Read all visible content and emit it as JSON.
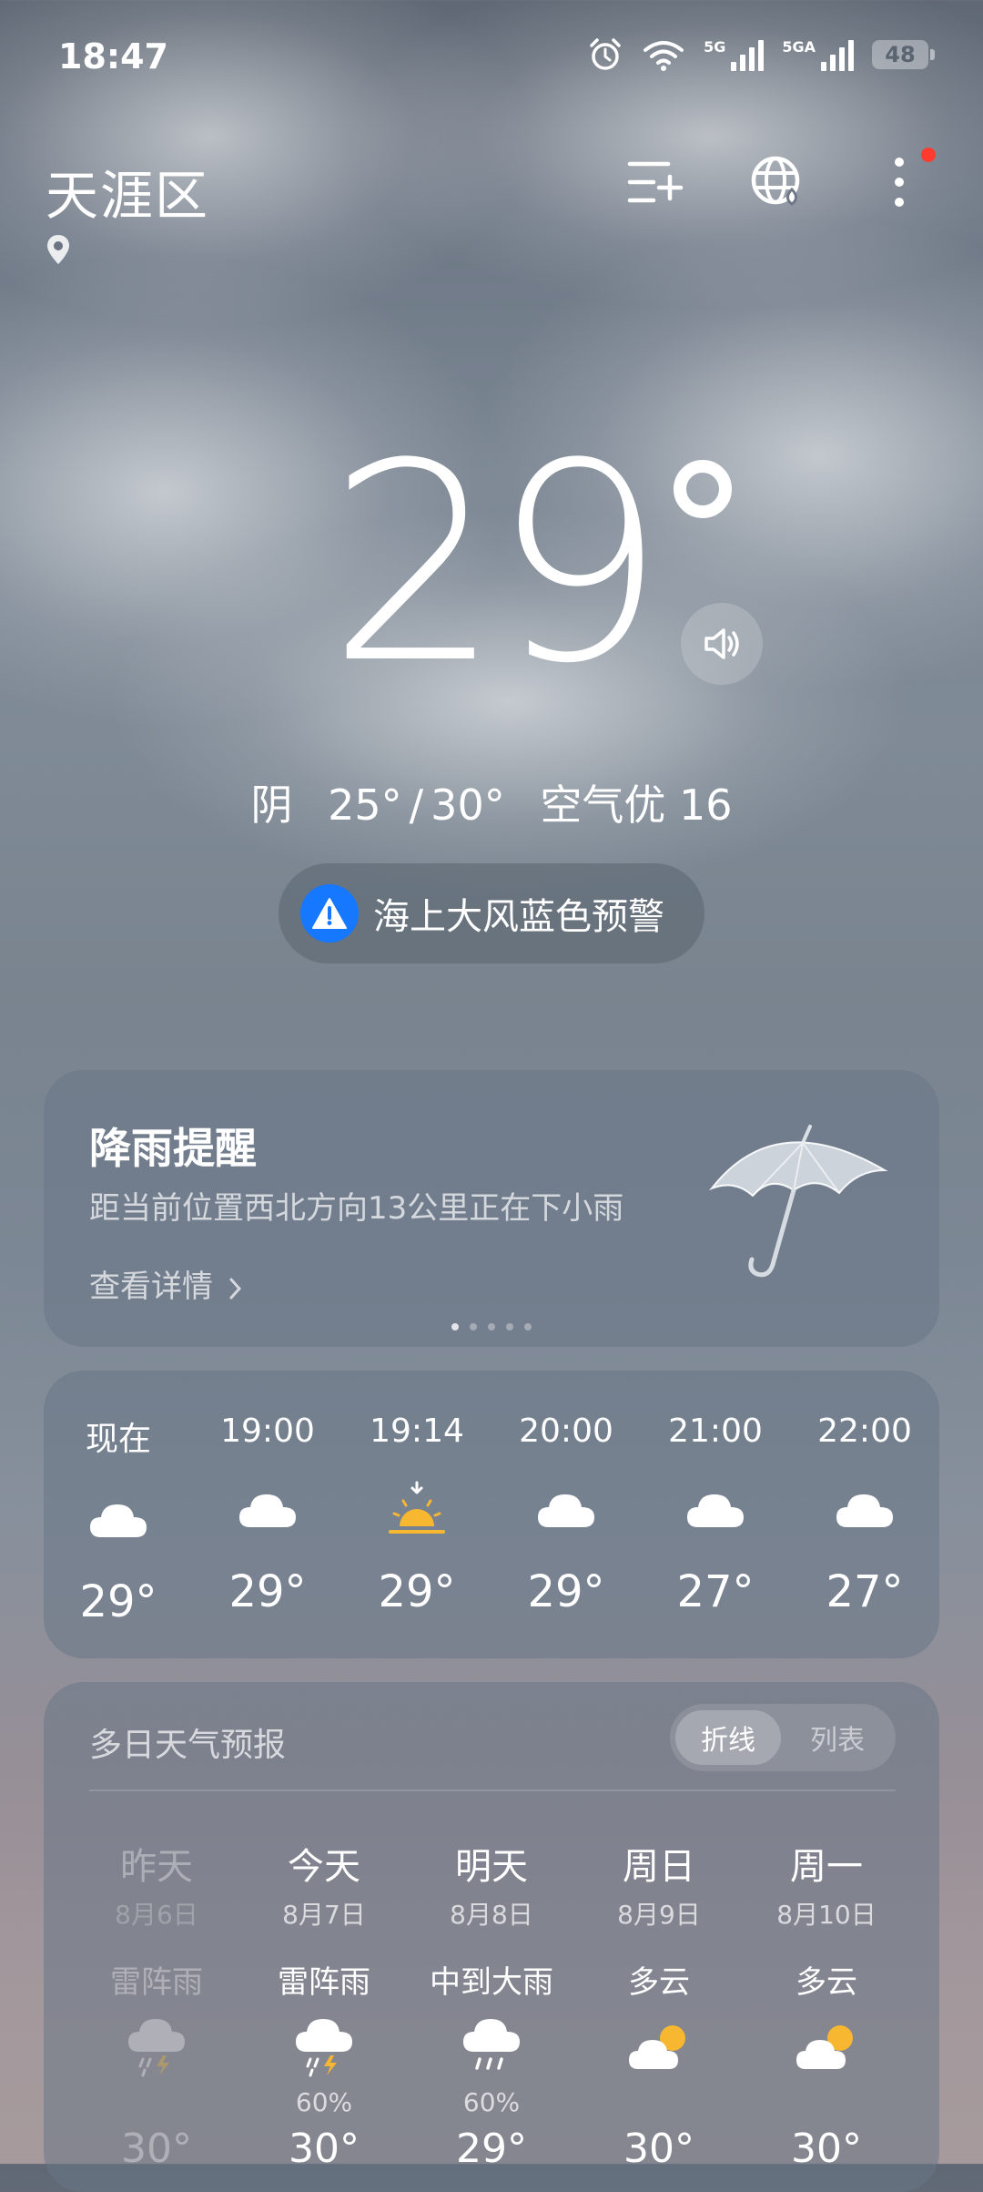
{
  "status_bar": {
    "time": "18:47",
    "signal1_label": "5G",
    "signal2_label": "5GA",
    "battery": "48"
  },
  "header": {
    "location": "天涯区",
    "icons": [
      "city-list-icon",
      "globe-icon",
      "more-icon"
    ]
  },
  "current": {
    "temperature": "29",
    "condition": "阴",
    "low": "25°",
    "high": "30°",
    "aqi_text": "空气优 16"
  },
  "alert": {
    "text": "海上大风蓝色预警"
  },
  "rain_card": {
    "title": "降雨提醒",
    "description": "距当前位置西北方向13公里正在下小雨",
    "link": "查看详情",
    "page_count": 5,
    "active_page": 1
  },
  "hourly": [
    {
      "time": "现在",
      "icon": "cloud-icon",
      "temp": "29°"
    },
    {
      "time": "19:00",
      "icon": "cloud-icon",
      "temp": "29°"
    },
    {
      "time": "19:14",
      "icon": "sunset-icon",
      "temp": "29°"
    },
    {
      "time": "20:00",
      "icon": "cloud-icon",
      "temp": "29°"
    },
    {
      "time": "21:00",
      "icon": "cloud-icon",
      "temp": "27°"
    },
    {
      "time": "22:00",
      "icon": "cloud-icon",
      "temp": "27°"
    }
  ],
  "daily": {
    "title": "多日天气预报",
    "toggle": {
      "line": "折线",
      "list": "列表",
      "selected": "折线"
    },
    "days": [
      {
        "name": "昨天",
        "date": "8月6日",
        "cond": "雷阵雨",
        "icon": "thunderstorm-icon",
        "precip": "",
        "high": "30°",
        "past": true
      },
      {
        "name": "今天",
        "date": "8月7日",
        "cond": "雷阵雨",
        "icon": "thunderstorm-icon",
        "precip": "60%",
        "high": "30°",
        "past": false
      },
      {
        "name": "明天",
        "date": "8月8日",
        "cond": "中到大雨",
        "icon": "heavy-rain-icon",
        "precip": "60%",
        "high": "29°",
        "past": false
      },
      {
        "name": "周日",
        "date": "8月9日",
        "cond": "多云",
        "icon": "partly-cloudy-icon",
        "precip": "",
        "high": "30°",
        "past": false
      },
      {
        "name": "周一",
        "date": "8月10日",
        "cond": "多云",
        "icon": "partly-cloudy-icon",
        "precip": "",
        "high": "30°",
        "past": false
      }
    ]
  },
  "colors": {
    "alert_blue": "#1677ff",
    "sun_yellow": "#f7b731",
    "notification_red": "#ff3b30"
  }
}
